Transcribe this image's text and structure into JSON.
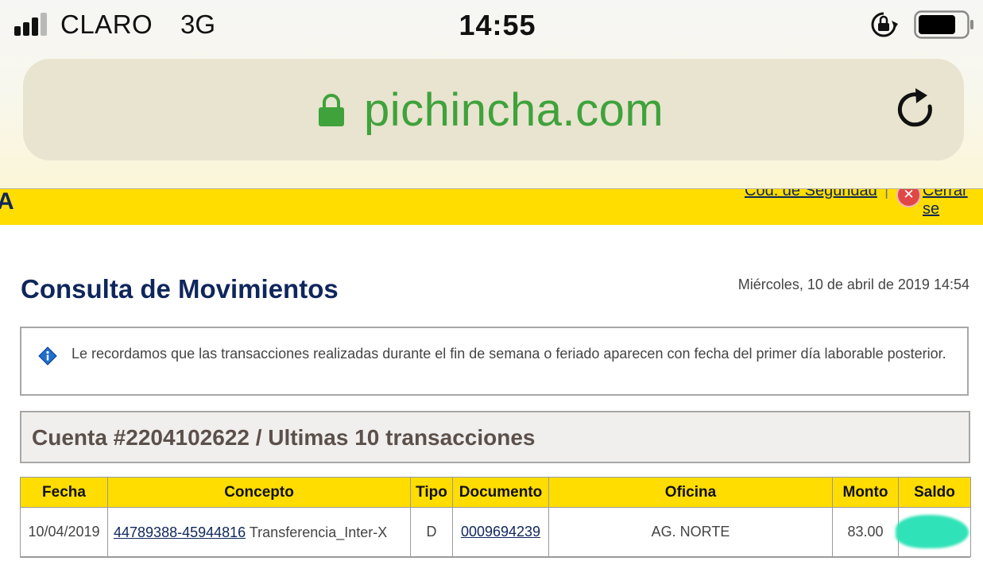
{
  "status_bar": {
    "carrier": "CLARO",
    "network": "3G",
    "time": "14:55"
  },
  "browser": {
    "url": "pichincha.com"
  },
  "header": {
    "brand_fragment": "A",
    "security_code_link": "Cód. de Seguridad",
    "separator": "|",
    "close_session_link": "Cerrar se"
  },
  "page": {
    "title": "Consulta de Movimientos",
    "datetime": "Miércoles, 10 de abril de 2019 14:54"
  },
  "notice": {
    "text": "Le recordamos que las transacciones realizadas durante el fin de semana o feriado aparecen con fecha del primer día laborable posterior."
  },
  "account": {
    "title": "Cuenta #2204102622 / Ultimas 10 transacciones"
  },
  "table": {
    "headers": [
      "Fecha",
      "Concepto",
      "Tipo",
      "Documento",
      "Oficina",
      "Monto",
      "Saldo"
    ],
    "rows": [
      {
        "fecha": "10/04/2019",
        "concepto_ref": "44789388-45944816",
        "concepto_text": " Transferencia_Inter-X",
        "tipo": "D",
        "documento": "0009694239",
        "oficina": "AG. NORTE",
        "monto": "83.00",
        "saldo": ""
      }
    ]
  },
  "colors": {
    "brand_yellow": "#ffdd00",
    "brand_navy": "#0f265c",
    "url_green": "#3fa23b",
    "redaction": "#2fe2b7"
  }
}
